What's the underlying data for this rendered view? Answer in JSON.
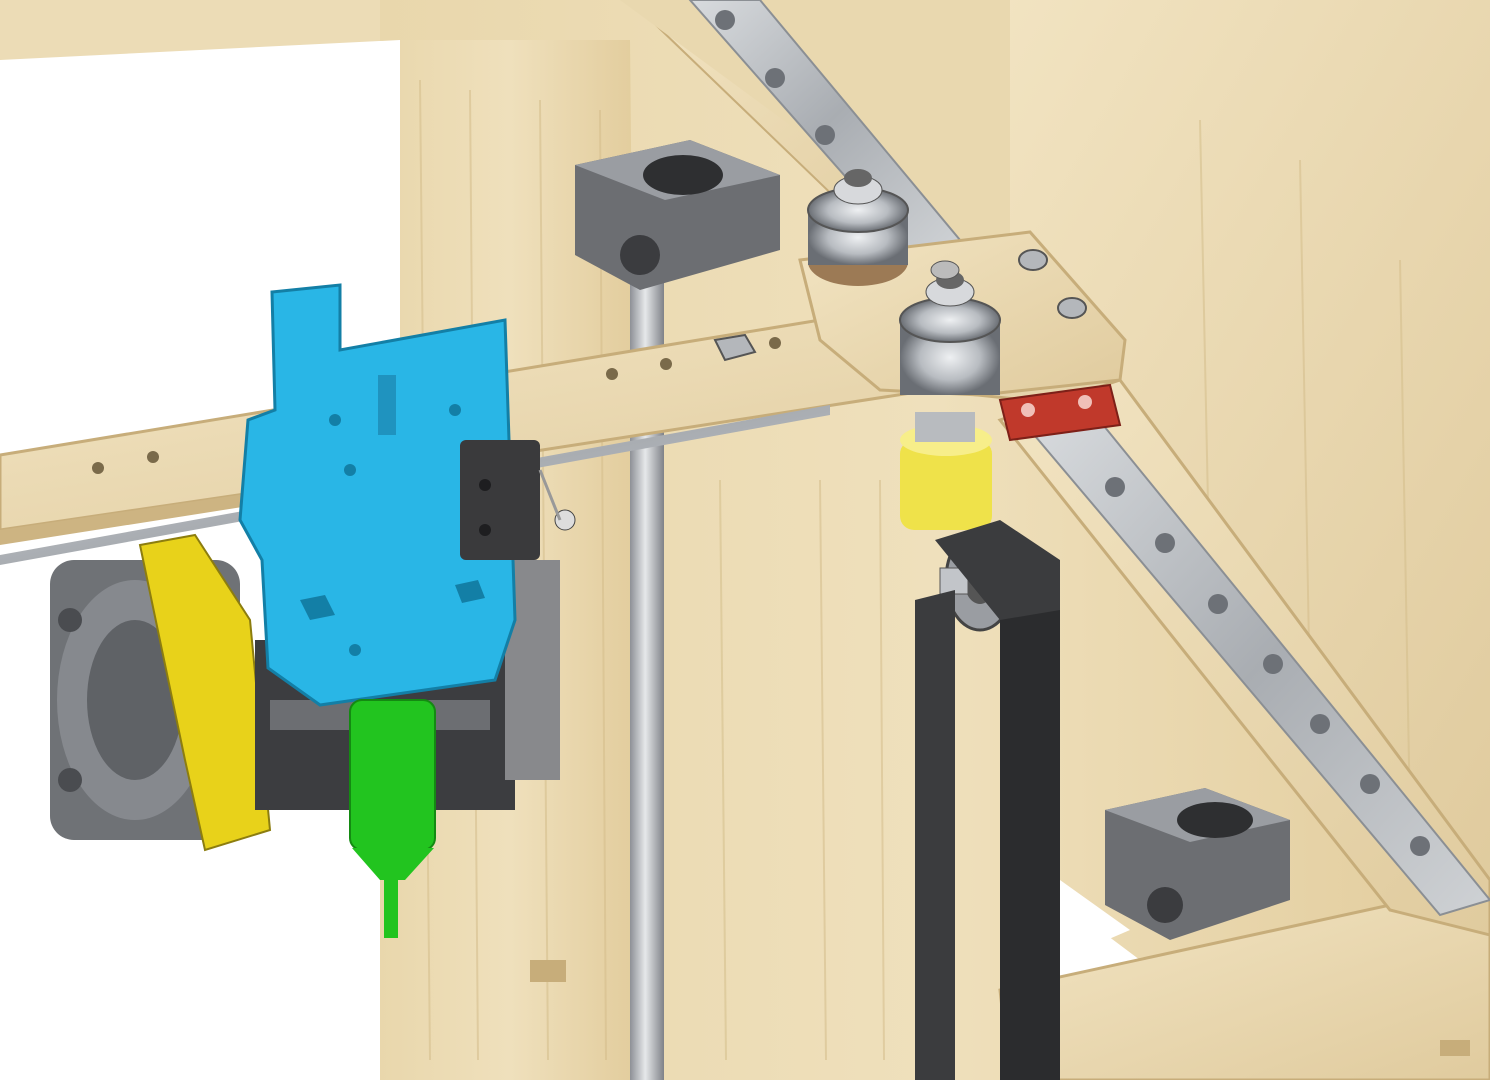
{
  "scene": {
    "subject": "3d-printer-corebxy-gantry-render",
    "colors": {
      "background": "#ffffff",
      "plywood": "#ecdcb6",
      "plywood_dark": "#d9c393",
      "plywood_edge": "#c7ad7a",
      "rail_steel": "#b9bcc0",
      "rail_hole": "#6d7177",
      "carriage_red": "#c0392b",
      "extruder_blue": "#29b6e6",
      "fan_yellow": "#e8d21a",
      "nozzle_green": "#22c41f",
      "idler_yellow": "#efe24a",
      "belt_dark": "#3b3c3e",
      "shaft_support_gray": "#6c6e72",
      "fan_gray": "#6f7276",
      "microswitch_black": "#3a3a3c"
    },
    "parts": [
      "plywood-frame",
      "linear-rail-y",
      "linear-rail-x",
      "rail-carriage",
      "shaft-support-top",
      "shaft-support-bottom",
      "bearing-idler-top",
      "bearing-idler-bottom",
      "yellow-belt-idler",
      "gt2-belt",
      "belt-pulley",
      "extruder-mount",
      "endstop-microswitch",
      "hotend-fan",
      "fan-duct",
      "hotend-nozzle",
      "z-rod"
    ]
  }
}
